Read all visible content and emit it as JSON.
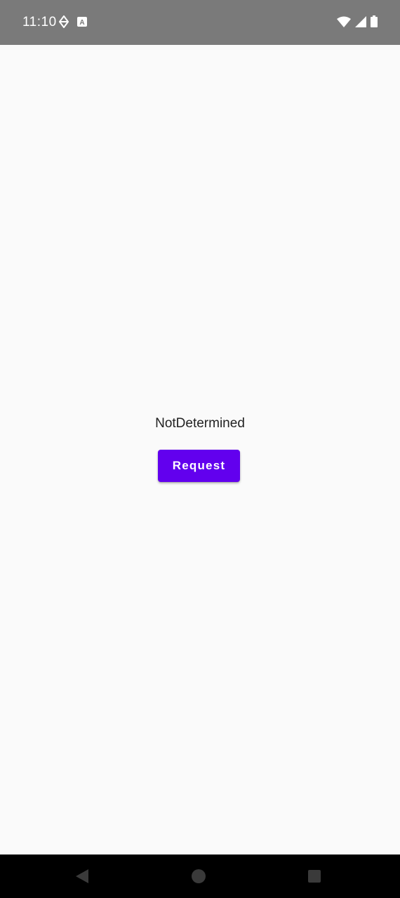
{
  "status_bar": {
    "time": "11:10",
    "left_icons": [
      "data-saver-icon",
      "app-notification-icon"
    ],
    "right_icons": [
      "wifi-icon",
      "cellular-signal-icon",
      "battery-icon"
    ],
    "background_color": "#7a7a7a"
  },
  "main": {
    "state_text": "NotDetermined",
    "request_button_label": "Request",
    "accent_color": "#6200ee"
  },
  "nav_bar": {
    "buttons": [
      "back-icon",
      "home-icon",
      "recents-icon"
    ]
  }
}
